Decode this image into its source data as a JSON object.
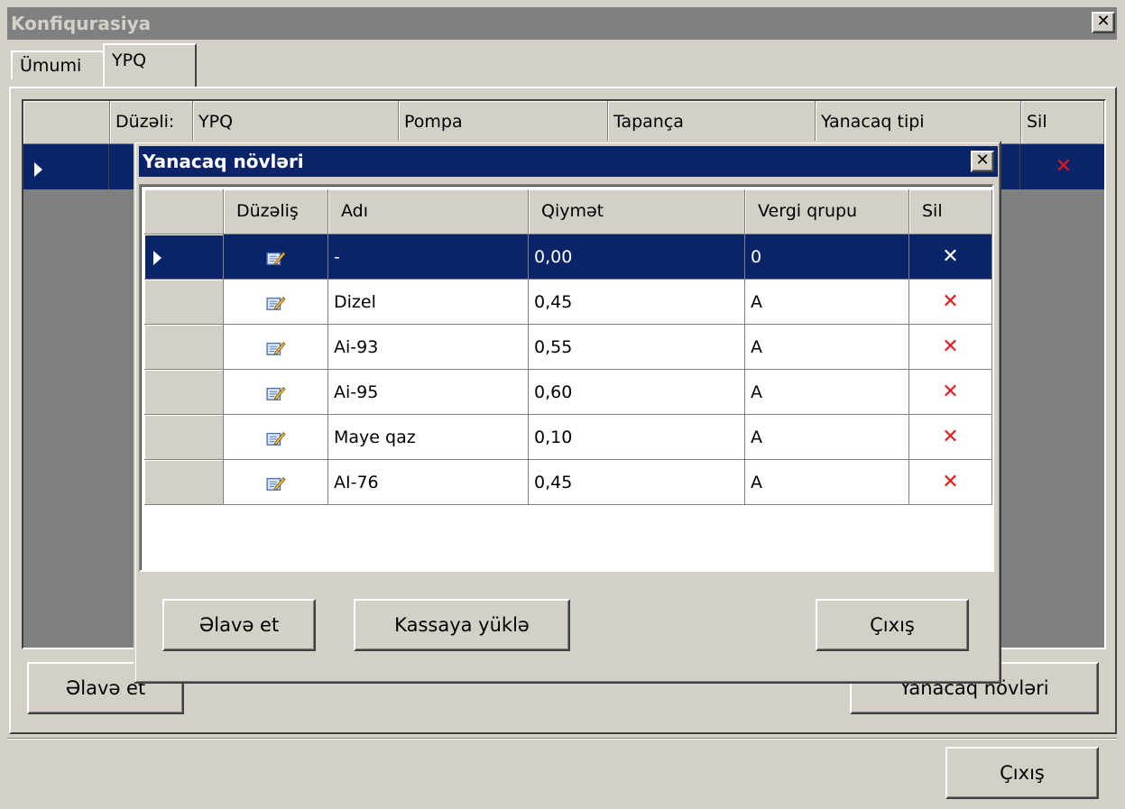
{
  "main_window": {
    "title": "Konfiqurasiya",
    "close_glyph": "✕",
    "tabs": [
      "Ümumi",
      "YPQ"
    ],
    "grid": {
      "columns": [
        "Düzəli:",
        "YPQ",
        "Pompa",
        "Tapança",
        "Yanacaq tipi",
        "Sil"
      ]
    },
    "add_button": "Əlavə et",
    "fuel_types_button": "Yanacaq növləri",
    "exit_button": "Çıxış"
  },
  "dialog": {
    "title": "Yanacaq növləri",
    "close_glyph": "✕",
    "columns": [
      "Düzəliş",
      "Adı",
      "Qiymət",
      "Vergi qrupu",
      "Sil"
    ],
    "rows": [
      {
        "name": "-",
        "price": "0,00",
        "tax_group": "0"
      },
      {
        "name": "Dizel",
        "price": "0,45",
        "tax_group": "A"
      },
      {
        "name": "Ai-93",
        "price": "0,55",
        "tax_group": "A"
      },
      {
        "name": "Ai-95",
        "price": "0,60",
        "tax_group": "A"
      },
      {
        "name": "Maye qaz",
        "price": "0,10",
        "tax_group": "A"
      },
      {
        "name": "AI-76",
        "price": "0,45",
        "tax_group": "A"
      }
    ],
    "add_button": "Əlavə et",
    "upload_button": "Kassaya yüklə",
    "exit_button": "Çıxış"
  },
  "icons": {
    "edit": "edit-icon",
    "delete": "delete-x-icon",
    "row_pointer": "row-pointer-icon"
  },
  "colors": {
    "selection": "#0a246a",
    "delete": "#e21b1b",
    "face": "#d4d0c8"
  }
}
